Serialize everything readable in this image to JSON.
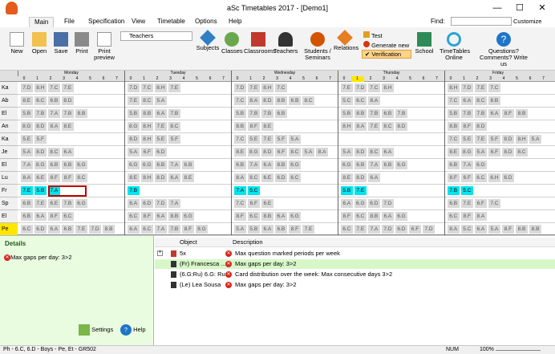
{
  "window": {
    "title": "aSc Timetables 2017 - [Demo1]"
  },
  "menu": {
    "tabs": [
      "Main",
      "File",
      "Specification",
      "View",
      "Timetable",
      "Options",
      "Help"
    ],
    "find_label": "Find:",
    "customize": "Customize"
  },
  "ribbon": {
    "new": "New",
    "open": "Open",
    "save": "Save",
    "print": "Print",
    "print_preview": "Print preview",
    "view_select": "Teachers",
    "subjects": "Subjects",
    "classes": "Classes",
    "classrooms": "Classrooms",
    "teachers": "Teachers",
    "students": "Students / Seminars",
    "relations": "Relations",
    "test": "Test",
    "generate": "Generate new",
    "verification": "Verification",
    "school": "School",
    "timetables_online": "TimeTables Online",
    "questions": "Questions? Comments? Write us"
  },
  "grid": {
    "days": [
      "Monday",
      "Tuesday",
      "Wednesday",
      "Thursday",
      "Friday"
    ],
    "periods": [
      "0",
      "1",
      "2",
      "3",
      "4",
      "5",
      "6",
      "7"
    ],
    "classes": [
      "Ka",
      "Ab",
      "El",
      "An",
      "Ka",
      "Je",
      "El",
      "Lu",
      "Fr",
      "Sp",
      "El",
      "Pe"
    ],
    "rows": [
      [
        [
          "7.D",
          "8.H",
          "7.C",
          "7.E"
        ],
        [
          "7.D",
          "7.C",
          "8.H",
          "7.E"
        ],
        [
          "7.D",
          "7.E",
          "8.H",
          "7.C"
        ],
        [
          "7.E",
          "7.D",
          "7.C",
          "8.H"
        ],
        [
          "8.H",
          "7.D",
          "7.E",
          "7.C"
        ]
      ],
      [
        [
          "8.E",
          "6.C",
          "6.B",
          "8.D"
        ],
        [
          "7.E",
          "8.C",
          "5.A"
        ],
        [
          "7.C",
          "8.A",
          "8.D",
          "8.B",
          "6.B",
          "8.C"
        ],
        [
          "5.C",
          "6.C",
          "8.A"
        ],
        [
          "7.C",
          "6.A",
          "8.C",
          "8.B"
        ]
      ],
      [
        [
          "5.B",
          "7.B",
          "7.A",
          "7.B",
          "8.B"
        ],
        [
          "5.B",
          "8.B",
          "6.A",
          "7.B"
        ],
        [
          "5.B",
          "7.B",
          "7.B",
          "6.B"
        ],
        [
          "5.B",
          "8.B",
          "7.B",
          "6.B",
          "7.B"
        ],
        [
          "5.B",
          "7.B",
          "7.B",
          "6.A",
          "8.F",
          "8.B"
        ]
      ],
      [
        [
          "8.G",
          "8.D",
          "8.A",
          "8.E"
        ],
        [
          "8.G",
          "8.H",
          "7.E",
          "8.C"
        ],
        [
          "8.B",
          "8.F",
          "8.E"
        ],
        [
          "8.H",
          "8.A",
          "7.E",
          "8.C",
          "8.D"
        ],
        [
          "8.B",
          "8.F",
          "8.D"
        ]
      ],
      [
        [
          "5.E",
          "5.F"
        ],
        [
          "8.D",
          "8.H",
          "5.E",
          "5.F"
        ],
        [
          "7.C",
          "5.E",
          "7.E",
          "5.F",
          "5.A"
        ],
        [],
        [
          "7.C",
          "5.E",
          "7.E",
          "5.F",
          "8.D",
          "8.H",
          "5.A"
        ]
      ],
      [
        [
          "5.A",
          "8.D",
          "8.C",
          "6.A"
        ],
        [
          "5.A",
          "6.F",
          "6.D"
        ],
        [
          "8.E",
          "8.G",
          "8.D",
          "6.F",
          "8.C",
          "5.A",
          "8.A"
        ],
        [
          "5.A",
          "8.D",
          "8.C",
          "6.A"
        ],
        [
          "8.E",
          "8.G",
          "5.A",
          "6.F",
          "8.D",
          "8.C"
        ]
      ],
      [
        [
          "7.A",
          "8.G",
          "6.B",
          "6.B",
          "6.G"
        ],
        [
          "6.G",
          "6.G",
          "6.B",
          "7.A",
          "6.B"
        ],
        [
          "6.B",
          "7.A",
          "6.A",
          "8.B",
          "6.G"
        ],
        [
          "6.G",
          "6.B",
          "7.A",
          "6.B",
          "6.G"
        ],
        [
          "6.B",
          "7.A",
          "6.G"
        ]
      ],
      [
        [
          "8.A",
          "6.E",
          "8.F",
          "8.F",
          "8.C"
        ],
        [
          "8.E",
          "8.H",
          "8.D",
          "6.A",
          "8.E"
        ],
        [
          "8.A",
          "8.C",
          "6.E",
          "6.D",
          "6.C"
        ],
        [
          "8.E",
          "8.D",
          "6.A"
        ],
        [
          "8.F",
          "6.F",
          "6.C",
          "6.H",
          "6.D"
        ]
      ],
      [
        [
          "7.E",
          "5.B",
          "7.A"
        ],
        [
          "7.B"
        ],
        [
          "7.A",
          "5.C"
        ],
        [
          "5.B",
          "7.E"
        ],
        [
          "7.B",
          "5.C"
        ]
      ],
      [
        [
          "6.B",
          "7.E",
          "6.E",
          "7.B",
          "6.G"
        ],
        [
          "6.A",
          "6.D",
          "7.D",
          "7.A"
        ],
        [
          "7.C",
          "6.F",
          "6.E"
        ],
        [
          "6.A",
          "6.G",
          "6.D",
          "7.D"
        ],
        [
          "6.B",
          "7.E",
          "6.F",
          "7.C"
        ]
      ],
      [
        [
          "6.B",
          "6.A",
          "8.F",
          "6.C"
        ],
        [
          "6.C",
          "8.F",
          "6.A",
          "8.B",
          "6.G"
        ],
        [
          "8.F",
          "6.C",
          "8.B",
          "6.A",
          "6.G"
        ],
        [
          "8.F",
          "6.C",
          "8.B",
          "6.A",
          "6.G"
        ],
        [
          "6.C",
          "8.F",
          "8.A"
        ]
      ],
      [
        [
          "6.C",
          "6.D",
          "6.A",
          "6.B",
          "7.E",
          "7.D",
          "8.B"
        ],
        [
          "6.A",
          "6.C",
          "7.A",
          "7.B",
          "8.F",
          "8.G"
        ],
        [
          "5.A",
          "5.B",
          "6.A",
          "6.B",
          "8.F",
          "7.E"
        ],
        [
          "6.C",
          "7.E",
          "7.A",
          "7.D",
          "6.D",
          "6.F",
          "7.D"
        ],
        [
          "8.A",
          "5.C",
          "6.A",
          "5.A",
          "8.F",
          "8.B",
          "8.B"
        ]
      ]
    ]
  },
  "details": {
    "header": "Details",
    "message": "Max gaps per day: 3>2",
    "settings": "Settings",
    "help": "Help"
  },
  "list": {
    "col_object": "Object",
    "col_description": "Description",
    "rows": [
      {
        "object": "5x",
        "desc": "Max question marked periods per week"
      },
      {
        "object": "(Fr) Francesca ...",
        "desc": "Max gaps per day: 3>2"
      },
      {
        "object": "(6.G:Ru) 6.G: Ru...",
        "desc": "Card distribution over the week: Max consecutive days 3>2"
      },
      {
        "object": "(Le) Lea Sousa",
        "desc": "Max gaps per day: 3>2"
      }
    ]
  },
  "status": {
    "left": "Ph - 6.C, 6.D - Boys - Pe, Et - GR502",
    "num": "NUM",
    "zoom": "100%"
  }
}
